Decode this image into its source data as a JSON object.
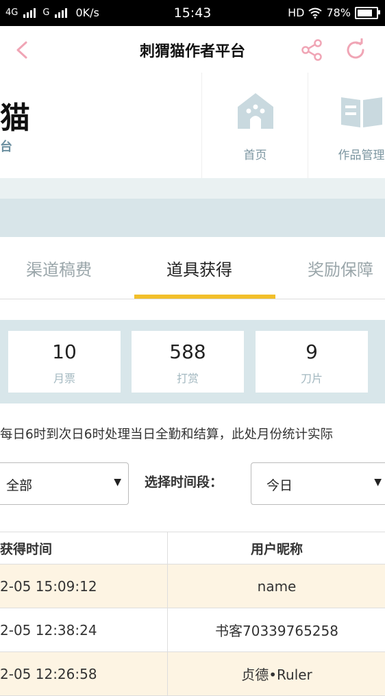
{
  "status_bar": {
    "network1": "4G",
    "network2": "G",
    "speed": "0K/s",
    "time": "15:43",
    "hd": "HD",
    "battery": "78%",
    "battery_level": 0.78
  },
  "nav": {
    "title": "刺猬猫作者平台",
    "accent": "#f0a5b5"
  },
  "header": {
    "logo_char": "猫",
    "logo_sub": "台",
    "quick_links": [
      {
        "label": "首页",
        "icon": "home-icon"
      },
      {
        "label": "作品管理",
        "icon": "book-icon"
      }
    ]
  },
  "tabs": [
    {
      "label": "渠道稿费",
      "active": false
    },
    {
      "label": "道具获得",
      "active": true
    },
    {
      "label": "奖励保障",
      "active": false
    }
  ],
  "stats": [
    {
      "value": "10",
      "label": "月票"
    },
    {
      "value": "588",
      "label": "打赏"
    },
    {
      "value": "9",
      "label": "刀片"
    }
  ],
  "notice": "每日6时到次日6时处理当日全勤和结算，此处月份统计实际",
  "filters": {
    "type_value": "全部",
    "period_label": "选择时间段：",
    "period_value": "今日"
  },
  "table": {
    "headers": [
      "获得时间",
      "用户昵称"
    ],
    "rows": [
      {
        "time": "2-05 15:09:12",
        "user": "name"
      },
      {
        "time": "2-05 12:38:24",
        "user": "书客70339765258"
      },
      {
        "time": "2-05 12:26:58",
        "user": "贞德•Ruler"
      }
    ]
  }
}
